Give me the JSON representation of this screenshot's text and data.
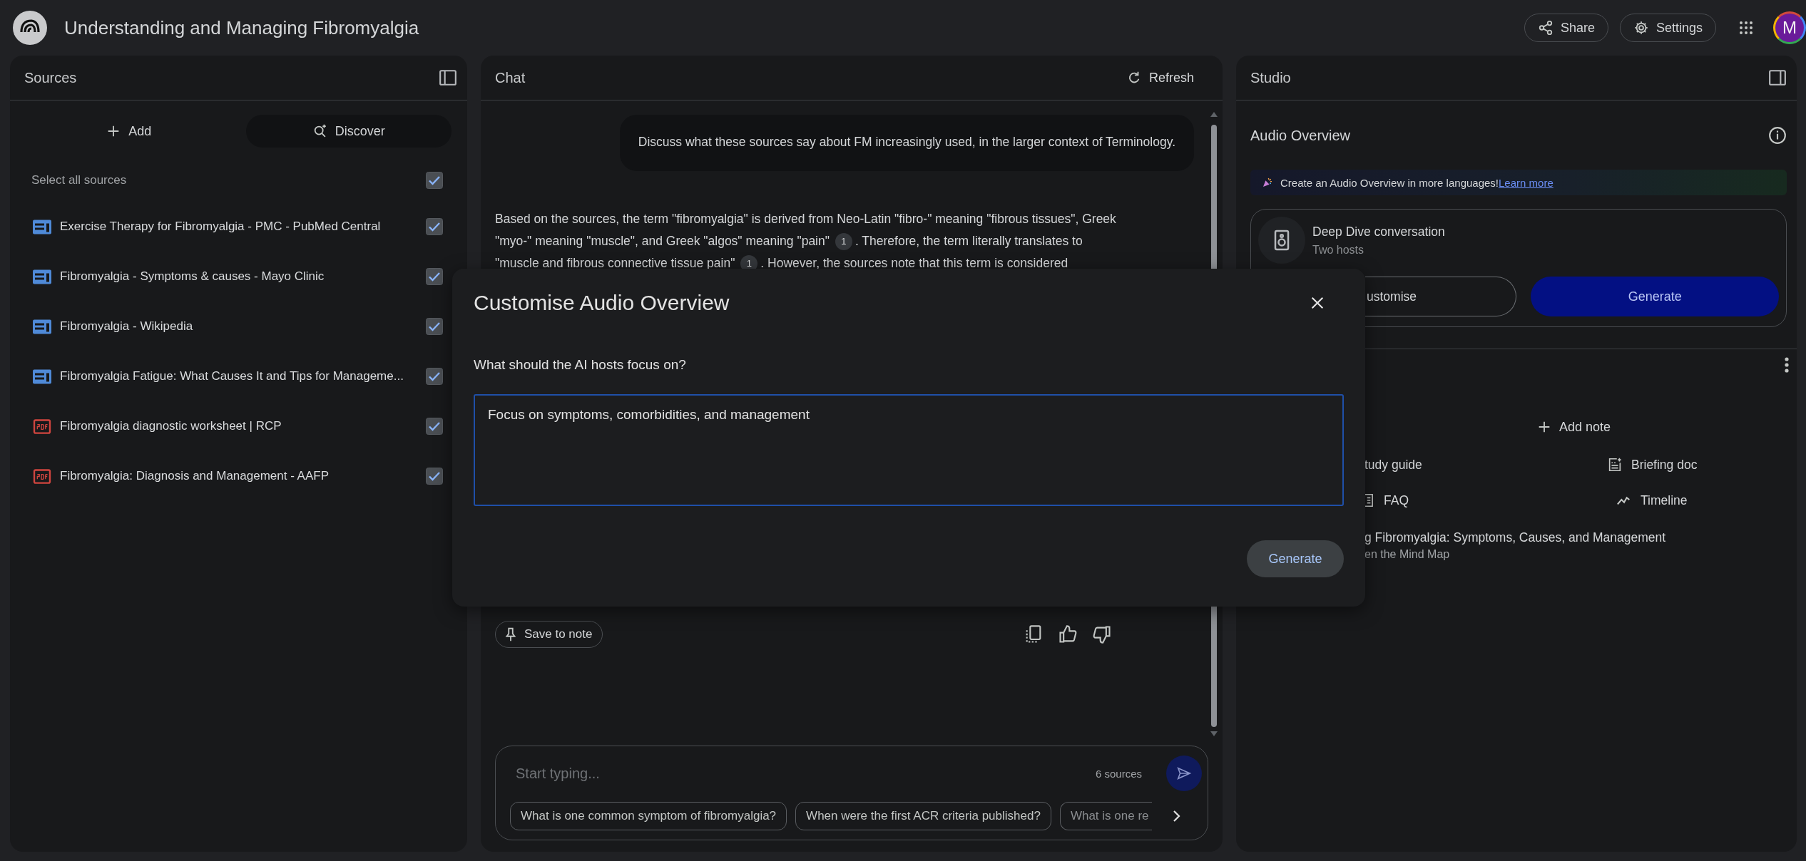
{
  "header": {
    "title": "Understanding and Managing Fibromyalgia",
    "buttons": [
      {
        "kind": "share",
        "label": "Share"
      },
      {
        "kind": "settings",
        "label": "Settings"
      }
    ],
    "avatar": "M"
  },
  "sources": {
    "title": "Sources",
    "add": "Add",
    "discover": "Discover",
    "select_all": {
      "label": "Select all sources",
      "checked": true
    },
    "items": [
      {
        "title": "Exercise Therapy for Fibromyalgia - PMC - PubMed Central",
        "kind": "web",
        "checked": true
      },
      {
        "title": "Fibromyalgia - Symptoms & causes - Mayo Clinic",
        "kind": "web",
        "checked": true
      },
      {
        "title": "Fibromyalgia - Wikipedia",
        "kind": "web",
        "checked": true
      },
      {
        "title": "Fibromyalgia Fatigue: What Causes It and Tips for Manageme...",
        "kind": "web",
        "checked": true
      },
      {
        "title": "Fibromyalgia diagnostic worksheet | RCP",
        "kind": "pdf",
        "checked": true
      },
      {
        "title": "Fibromyalgia: Diagnosis and Management - AAFP",
        "kind": "pdf",
        "checked": true
      }
    ]
  },
  "chat": {
    "title": "Chat",
    "refresh": "Refresh",
    "user_message": "Discuss what these sources say about FM increasingly used, in the larger context of Terminology.",
    "response_lines": [
      [
        {
          "kind": "text",
          "text": "Based on the sources, the term \"fibromyalgia\" is derived from Neo-Latin \"fibro-\" meaning \"fibrous tissues\", Greek"
        }
      ],
      [
        {
          "kind": "text",
          "text": "\"myo-\" meaning \"muscle\", and Greek \"algos\" meaning \"pain\""
        },
        {
          "kind": "cite",
          "text": "1"
        },
        {
          "kind": "text",
          "text": ". Therefore, the term literally translates to"
        }
      ],
      [
        {
          "kind": "text",
          "text": "\"muscle and fibrous connective tissue pain\""
        },
        {
          "kind": "cite",
          "text": "1"
        },
        {
          "kind": "text",
          "text": ". However, the sources note that this term is considered"
        }
      ]
    ],
    "save_note": "Save to note",
    "placeholder": "Start typing...",
    "source_count": "6 sources",
    "suggestions": [
      "What is one common symptom of fibromyalgia?",
      "When were the first ACR criteria published?",
      "What is one re"
    ]
  },
  "studio": {
    "title": "Studio",
    "audio_title": "Audio Overview",
    "banner": "Create an Audio Overview in more languages!",
    "banner_link": "Learn more",
    "card_title": "Deep Dive conversation",
    "card_subtitle": "Two hosts",
    "customise": "ustomise",
    "generate": "Generate",
    "add_note": "Add note",
    "actions": [
      {
        "kind": "study",
        "label": "tudy guide"
      },
      {
        "kind": "briefing",
        "label": "Briefing doc"
      },
      {
        "kind": "faq",
        "label": "FAQ"
      },
      {
        "kind": "timeline",
        "label": "Timeline"
      }
    ],
    "note": {
      "title": "g Fibromyalgia: Symptoms, Causes, and Management",
      "subtitle": "en the Mind Map"
    }
  },
  "modal": {
    "title": "Customise Audio Overview",
    "question": "What should the AI hosts focus on?",
    "value": "Focus on symptoms, comorbidities, and management",
    "button": "Generate"
  }
}
